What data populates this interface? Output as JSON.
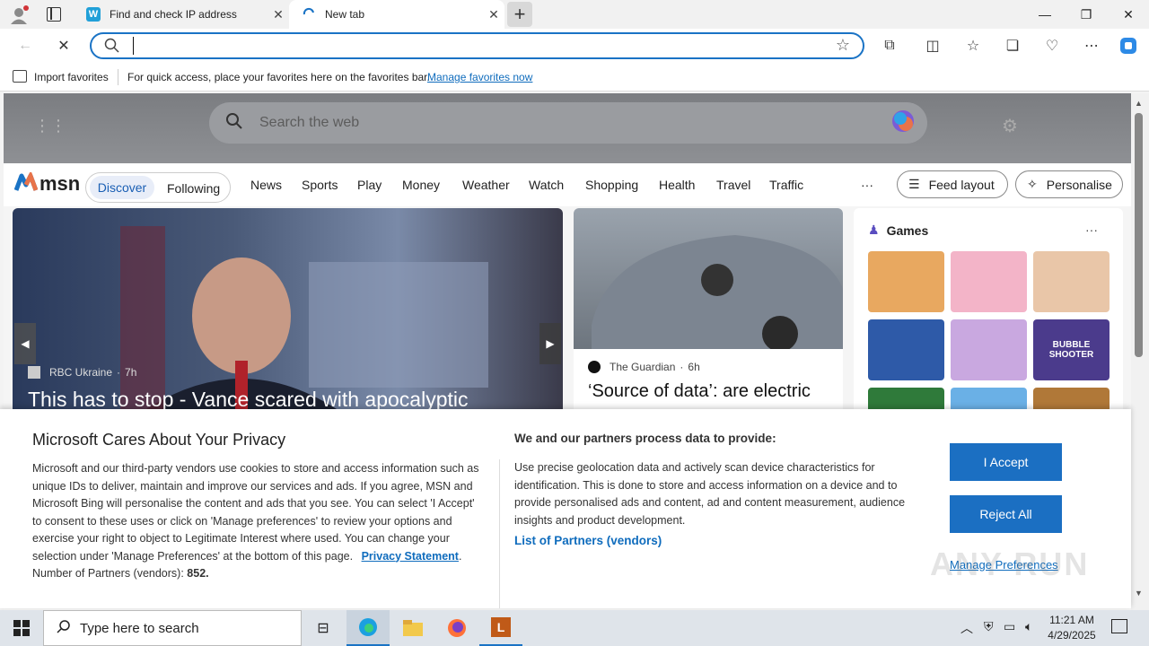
{
  "browser": {
    "tabs": [
      {
        "title": "Find and check IP address",
        "favicon": "W"
      },
      {
        "title": "New tab"
      }
    ],
    "new_tab_symbol": "+",
    "address_value": "",
    "favorites_bar": {
      "import_label": "Import favorites",
      "hint": "For quick access, place your favorites here on the favorites bar.",
      "manage_link": "Manage favorites now"
    }
  },
  "msn": {
    "search_placeholder": "Search the web",
    "logo_text": "msn",
    "tabs": [
      "Discover",
      "Following"
    ],
    "nav": [
      "News",
      "Sports",
      "Play",
      "Money",
      "Weather",
      "Watch",
      "Shopping",
      "Health",
      "Travel",
      "Traffic"
    ],
    "more": "···",
    "feed_layout": "Feed layout",
    "personalise": "Personalise",
    "hero": {
      "source": "RBC Ukraine",
      "age": "7h",
      "headline": "This has to stop - Vance scared with apocalyptic"
    },
    "second": {
      "source": "The Guardian",
      "age": "6h",
      "headline": "‘Source of data’: are electric"
    },
    "games_title": "Games",
    "games_more": "···",
    "game_tiles": [
      {
        "color": "#e8a860",
        "label": ""
      },
      {
        "color": "#f3b4c8",
        "label": ""
      },
      {
        "color": "#e9c6a8",
        "label": ""
      },
      {
        "color": "#2e5aa8",
        "label": ""
      },
      {
        "color": "#c9a8e0",
        "label": ""
      },
      {
        "color": "#4b3b8c",
        "label": "BUBBLE SHOOTER"
      },
      {
        "color": "#2f7a3a",
        "label": ""
      },
      {
        "color": "#6ab0e6",
        "label": ""
      },
      {
        "color": "#b07838",
        "label": ""
      }
    ]
  },
  "privacy": {
    "title": "Microsoft Cares About Your Privacy",
    "body": "Microsoft and our third-party vendors use cookies to store and access information such as unique IDs to deliver, maintain and improve our services and ads. If you agree, MSN and Microsoft Bing will personalise the content and ads that you see. You can select 'I Accept' to consent to these uses or click on 'Manage preferences' to review your options and exercise your right to object to Legitimate Interest where used.  You can change your selection under 'Manage Preferences' at the bottom of this page.",
    "privacy_link": "Privacy Statement",
    "partners_label": "Number of Partners (vendors):",
    "partners_count": "852.",
    "right_title": "We and our partners process data to provide:",
    "right_body": "Use precise geolocation data and actively scan device characteristics for identification. This is done to store and access information on a device and to provide personalised ads and content, ad and content measurement, audience insights and product development.",
    "vendors_link": "List of Partners (vendors)",
    "accept": "I Accept",
    "reject": "Reject All",
    "manage": "Manage Preferences"
  },
  "taskbar": {
    "search_placeholder": "Type here to search",
    "time": "11:21 AM",
    "date": "4/29/2025"
  },
  "watermark": "ANY RUN",
  "colors": {
    "accent": "#1b6fc2",
    "link": "#0f6cbd",
    "msn_tab_selected": "#e8edf8"
  }
}
